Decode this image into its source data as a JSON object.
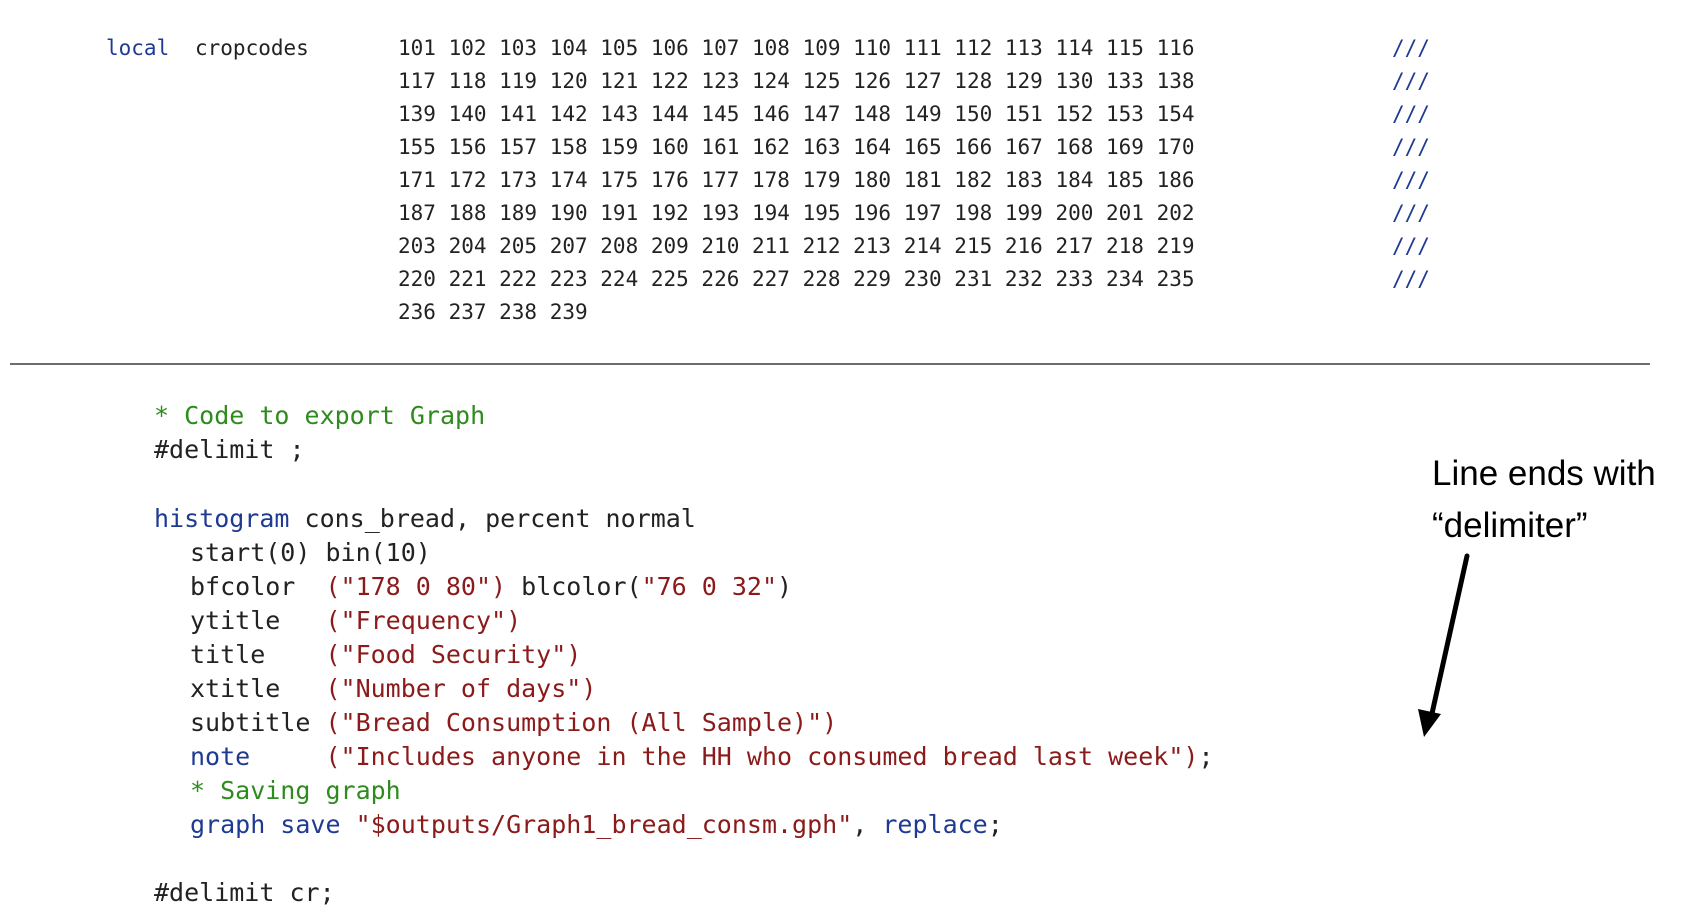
{
  "top_code": {
    "keyword": "local",
    "macro_name": "cropcodes",
    "rows": [
      "101 102 103 104 105 106 107 108 109 110 111 112 113 114 115 116",
      "117 118 119 120 121 122 123 124 125 126 127 128 129 130 133 138",
      "139 140 141 142 143 144 145 146 147 148 149 150 151 152 153 154",
      "155 156 157 158 159 160 161 162 163 164 165 166 167 168 169 170",
      "171 172 173 174 175 176 177 178 179 180 181 182 183 184 185 186",
      "187 188 189 190 191 192 193 194 195 196 197 198 199 200 201 202",
      "203 204 205 207 208 209 210 211 212 213 214 215 216 217 218 219",
      "220 221 222 223 224 225 226 227 228 229 230 231 232 233 234 235",
      "236 237 238 239"
    ],
    "continuation": "///"
  },
  "bottom_code": {
    "comment1": "* Code to export Graph",
    "delimit_start": "#delimit ;",
    "histogram_kw": "histogram",
    "histogram_args": " cons_bread, percent normal",
    "start_bin": "start(0) bin(10)",
    "bfcolor_opt": "bfcolor  ",
    "bfcolor_val": "(\"178 0 80\")",
    "blcolor_opt": " blcolor(",
    "blcolor_val": "\"76 0 32\"",
    "blcolor_close": ")",
    "ytitle_opt": "ytitle   ",
    "ytitle_val": "(\"Frequency\")",
    "title_opt": "title    ",
    "title_val": "(\"Food Security\")",
    "xtitle_opt": "xtitle   ",
    "xtitle_val": "(\"Number of days\")",
    "subtitle_opt": "subtitle ",
    "subtitle_val": "(\"Bread Consumption (All Sample)\")",
    "note_opt": "note     ",
    "note_val": "(\"Includes anyone in the HH who consumed bread last week\")",
    "note_end": ";",
    "comment2": "* Saving graph",
    "graph_kw": "graph save",
    "graph_path": " \"$outputs/Graph1_bread_consm.gph\"",
    "graph_comma": ", ",
    "graph_replace": "replace",
    "graph_end": ";",
    "delimit_end": "#delimit cr;"
  },
  "annotation": {
    "line1": "Line ends with",
    "line2": "“delimiter”"
  }
}
